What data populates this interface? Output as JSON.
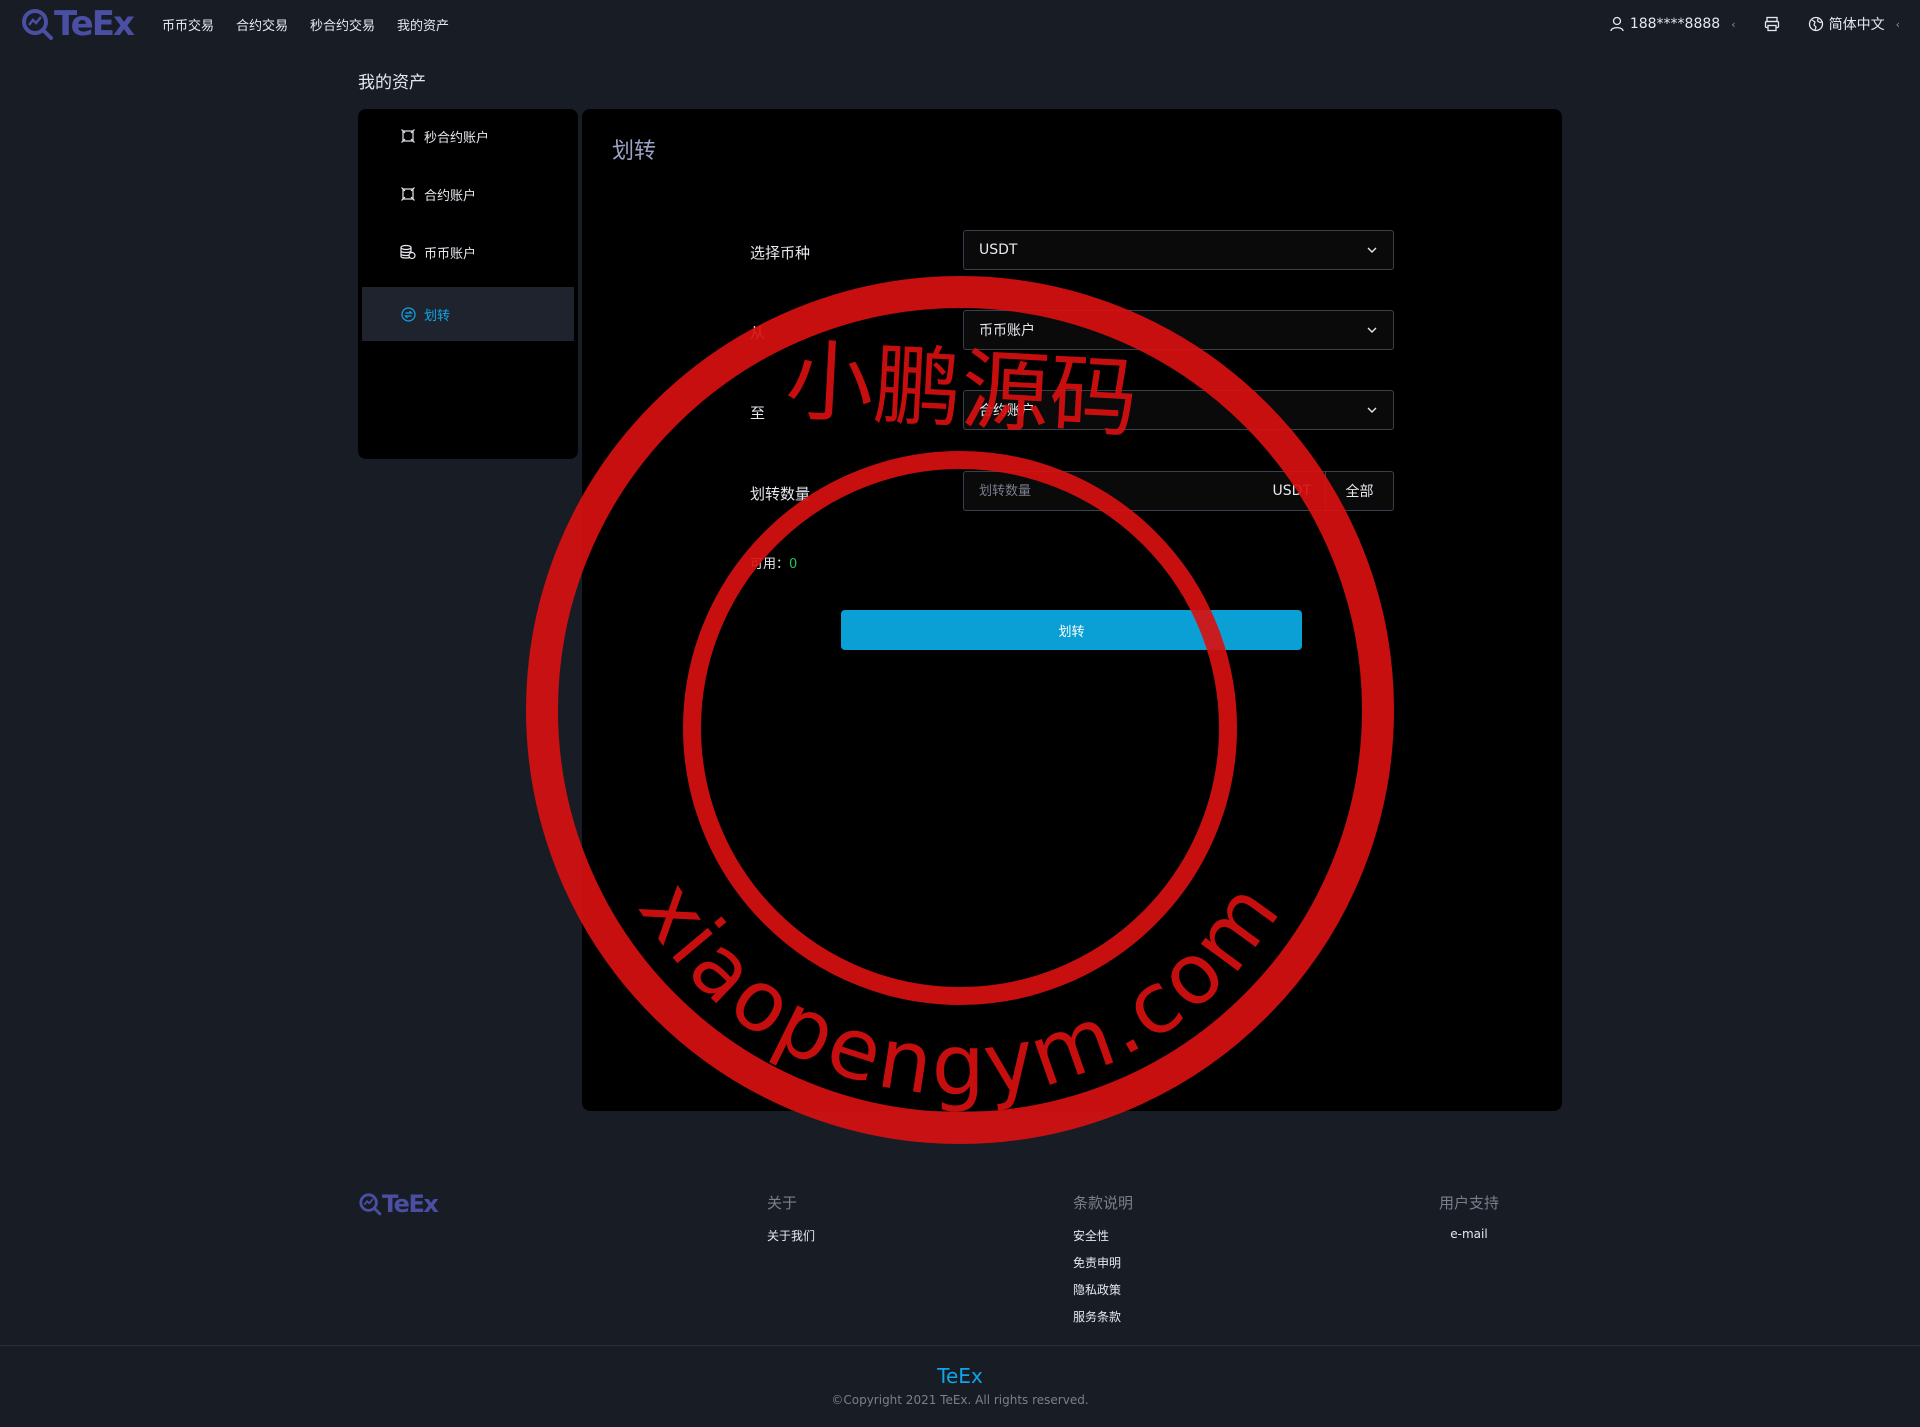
{
  "header": {
    "logo": "TeEx",
    "nav": [
      "币币交易",
      "合约交易",
      "秒合约交易",
      "我的资产"
    ],
    "user": "188****8888",
    "language": "简体中文"
  },
  "page_title": "我的资产",
  "sidebar": {
    "items": [
      {
        "label": "秒合约账户",
        "icon": "contract-icon"
      },
      {
        "label": "合约账户",
        "icon": "contract-icon"
      },
      {
        "label": "币币账户",
        "icon": "coin-stack-icon"
      },
      {
        "label": "划转",
        "icon": "transfer-icon",
        "active": true
      }
    ]
  },
  "transfer": {
    "title": "划转",
    "coin_label": "选择币种",
    "coin_value": "USDT",
    "from_label": "从",
    "from_value": "币币账户",
    "to_label": "至",
    "to_value": "合约账户",
    "amount_label": "划转数量",
    "amount_placeholder": "划转数量",
    "amount_unit": "USDT",
    "all_label": "全部",
    "available_label": "可用：",
    "available_value": "0",
    "submit_label": "划转"
  },
  "stamp": {
    "chinese": "小鹏源码",
    "url": "xiaopengym.com",
    "color": "#d81010"
  },
  "footer": {
    "logo": "TeEx",
    "about": {
      "title": "关于",
      "links": [
        "关于我们"
      ]
    },
    "terms": {
      "title": "条款说明",
      "links": [
        "安全性",
        "免责申明",
        "隐私政策",
        "服务条款"
      ]
    },
    "support": {
      "title": "用户支持",
      "links": [
        "e-mail"
      ]
    },
    "brand": "TeEx",
    "copyright": "©Copyright 2021 TeEx. All rights reserved."
  },
  "colors": {
    "background": "#181c25",
    "panel": "#000000",
    "accent": "#0ea5e9",
    "button": "#0aa0d6",
    "logo": "#4a4fa3",
    "available": "#22c55e"
  }
}
